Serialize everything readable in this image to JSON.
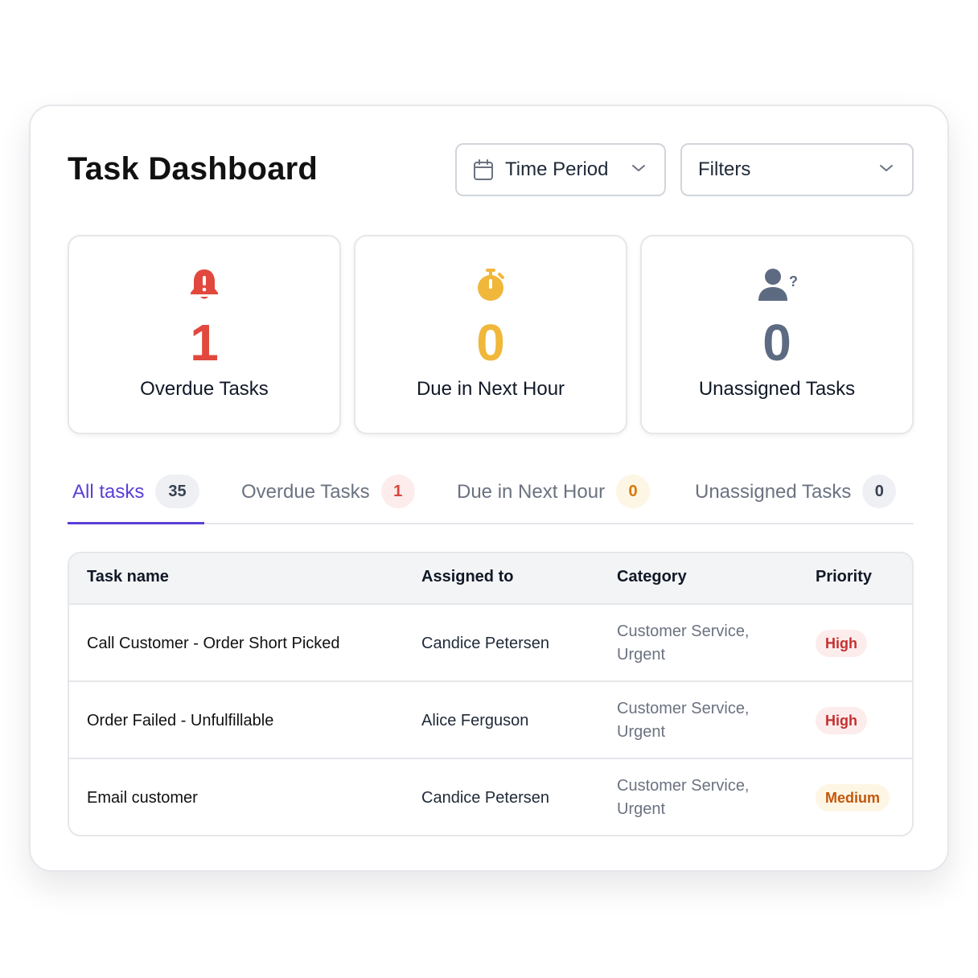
{
  "header": {
    "title": "Task Dashboard",
    "time_period_label": "Time Period",
    "filters_label": "Filters"
  },
  "stats": [
    {
      "value": "1",
      "label": "Overdue Tasks",
      "color": "#e2483d",
      "icon": "bell-alert-icon"
    },
    {
      "value": "0",
      "label": "Due in Next Hour",
      "color": "#f0b73a",
      "icon": "stopwatch-icon"
    },
    {
      "value": "0",
      "label": "Unassigned Tasks",
      "color": "#5d6b82",
      "icon": "user-question-icon"
    }
  ],
  "tabs": [
    {
      "label": "All tasks",
      "count": "35",
      "active": true
    },
    {
      "label": "Overdue Tasks",
      "count": "1"
    },
    {
      "label": "Due in Next Hour",
      "count": "0"
    },
    {
      "label": "Unassigned Tasks",
      "count": "0"
    }
  ],
  "table": {
    "columns": [
      "Task name",
      "Assigned to",
      "Category",
      "Priority"
    ],
    "rows": [
      {
        "task": "Call Customer - Order Short Picked",
        "assigned": "Candice Petersen",
        "category": "Customer Service, Urgent",
        "priority": "High"
      },
      {
        "task": "Order Failed - Unfulfillable",
        "assigned": "Alice Ferguson",
        "category": "Customer Service, Urgent",
        "priority": "High"
      },
      {
        "task": "Email customer",
        "assigned": "Candice Petersen",
        "category": "Customer Service, Urgent",
        "priority": "Medium"
      }
    ]
  },
  "colors": {
    "accent": "#5b3fd6",
    "danger": "#e2483d",
    "warning": "#f0b73a",
    "neutral": "#5d6b82"
  }
}
